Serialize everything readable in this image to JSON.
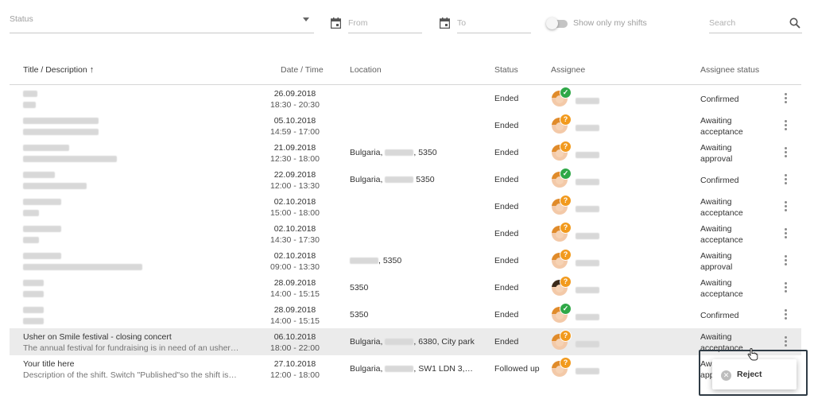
{
  "filters": {
    "status_placeholder": "Status",
    "from_placeholder": "From",
    "to_placeholder": "To",
    "toggle_label": "Show only my shifts",
    "toggle_on": false,
    "search_placeholder": "Search"
  },
  "table": {
    "headers": {
      "title": "Title / Description",
      "date": "Date / Time",
      "location": "Location",
      "status": "Status",
      "assignee": "Assignee",
      "assignee_status": "Assignee status"
    },
    "rows": [
      {
        "title": "",
        "desc": "",
        "date": "26.09.2018",
        "time": "18:30 - 20:30",
        "location": "",
        "status": "Ended",
        "badge": "check",
        "astatus1": "Confirmed",
        "astatus2": ""
      },
      {
        "title": "",
        "desc": "",
        "date": "05.10.2018",
        "time": "14:59 - 17:00",
        "location": "",
        "status": "Ended",
        "badge": "wait",
        "astatus1": "Awaiting",
        "astatus2": "acceptance"
      },
      {
        "title": "",
        "desc": "",
        "date": "21.09.2018",
        "time": "12:30 - 18:00",
        "location": "Bulgaria,",
        "location_tail": ", 5350",
        "status": "Ended",
        "badge": "wait",
        "astatus1": "Awaiting",
        "astatus2": "approval"
      },
      {
        "title": "",
        "desc": "",
        "date": "22.09.2018",
        "time": "12:00 - 13:30",
        "location": "Bulgaria,",
        "location_tail": " 5350",
        "status": "Ended",
        "badge": "check",
        "astatus1": "Confirmed",
        "astatus2": ""
      },
      {
        "title": "",
        "desc": "",
        "date": "02.10.2018",
        "time": "15:00 - 18:00",
        "location": "",
        "status": "Ended",
        "badge": "wait",
        "astatus1": "Awaiting",
        "astatus2": "acceptance"
      },
      {
        "title": "",
        "desc": "",
        "date": "02.10.2018",
        "time": "14:30 - 17:30",
        "location": "",
        "status": "Ended",
        "badge": "wait",
        "astatus1": "Awaiting",
        "astatus2": "acceptance"
      },
      {
        "title": "",
        "desc": "",
        "date": "02.10.2018",
        "time": "09:00 - 13:30",
        "location": "",
        "location_tail": ", 5350",
        "status": "Ended",
        "badge": "wait",
        "astatus1": "Awaiting",
        "astatus2": "approval"
      },
      {
        "title": "",
        "desc": "",
        "date": "28.09.2018",
        "time": "14:00 - 15:15",
        "location": "5350",
        "status": "Ended",
        "badge": "wait",
        "astatus1": "Awaiting",
        "astatus2": "acceptance"
      },
      {
        "title": "",
        "desc": "",
        "date": "28.09.2018",
        "time": "14:00 - 15:15",
        "location": "5350",
        "status": "Ended",
        "badge": "check",
        "astatus1": "Confirmed",
        "astatus2": ""
      },
      {
        "title": "Usher on Smile festival - closing concert",
        "desc": "The annual festival for fundraising is in need of an usher…",
        "date": "06.10.2018",
        "time": "18:00 - 22:00",
        "location": "Bulgaria,",
        "location_tail": ", 6380, City park",
        "status": "Ended",
        "badge": "wait",
        "astatus1": "Awaiting",
        "astatus2": "acceptance"
      },
      {
        "title": "Your title here",
        "desc": "Description of the shift. Switch \"Published\"so the shift is…",
        "date": "27.10.2018",
        "time": "12:00 - 18:00",
        "location": "Bulgaria,",
        "location_tail": ", SW1 LDN 3,…",
        "status": "Followed up",
        "badge": "wait",
        "astatus1": "Awa",
        "astatus2": "app"
      }
    ]
  },
  "popup": {
    "reject_label": "Reject"
  }
}
